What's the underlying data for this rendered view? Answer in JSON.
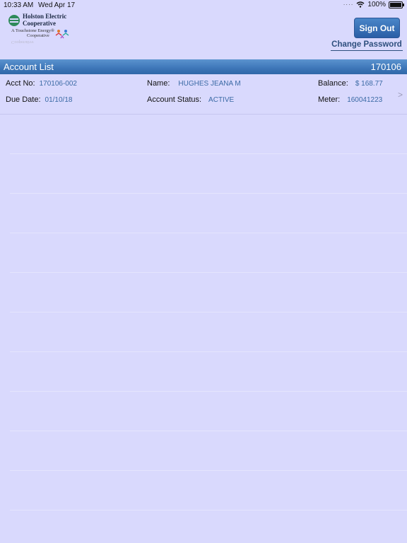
{
  "status": {
    "time": "10:33 AM",
    "date": "Wed Apr 17",
    "battery": "100%",
    "icons": [
      "signal-dots-icon",
      "wifi-icon",
      "battery-icon"
    ]
  },
  "logo": {
    "line1": "Holston Electric",
    "line2": "Cooperative",
    "tag1": "A Touchstone Energy®",
    "tag2": "Cooperative"
  },
  "actions": {
    "sign_out": "Sign Out",
    "change_password": "Change Password"
  },
  "header": {
    "title": "Account List",
    "number": "170106"
  },
  "account": {
    "acct_label": "Acct No:",
    "acct_value": "170106-002",
    "name_label": "Name:",
    "name_value": "HUGHES JEANA M",
    "balance_label": "Balance:",
    "balance_value": "$ 168.77",
    "due_label": "Due Date:",
    "due_value": "01/10/18",
    "status_label": "Account Status:",
    "status_value": "ACTIVE",
    "meter_label": "Meter:",
    "meter_value": "160041223",
    "chevron": ">"
  },
  "colors": {
    "background": "#d9d9fd",
    "header_bar": "#3d76b8",
    "value_text": "#3b6aa5",
    "button": "#2a5ea6"
  }
}
